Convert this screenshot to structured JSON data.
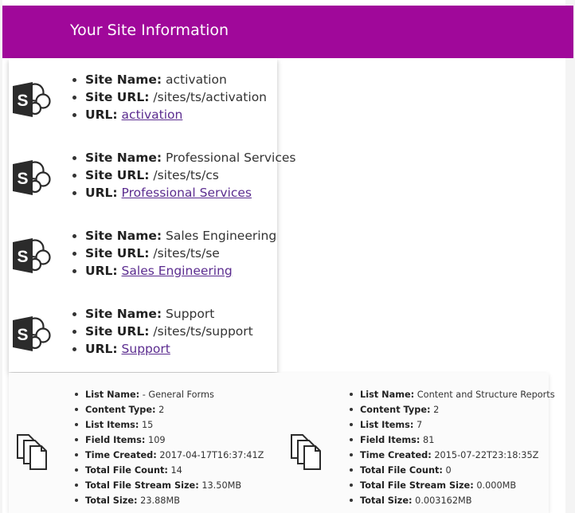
{
  "header": {
    "title": "Your Site Information",
    "color": "#a0089a"
  },
  "sites": [
    {
      "name_label": "Site Name:",
      "name": "activation",
      "site_url_label": "Site URL:",
      "site_url": "/sites/ts/activation",
      "url_label": "URL:",
      "url_text": "activation",
      "icon": "sharepoint-logo-icon"
    },
    {
      "name_label": "Site Name:",
      "name": "Professional Services",
      "site_url_label": "Site URL:",
      "site_url": "/sites/ts/cs",
      "url_label": "URL:",
      "url_text": "Professional Services",
      "icon": "sharepoint-logo-icon"
    },
    {
      "name_label": "Site Name:",
      "name": "Sales Engineering",
      "site_url_label": "Site URL:",
      "site_url": "/sites/ts/se",
      "url_label": "URL:",
      "url_text": "Sales Engineering",
      "icon": "sharepoint-logo-icon"
    },
    {
      "name_label": "Site Name:",
      "name": "Support",
      "site_url_label": "Site URL:",
      "site_url": "/sites/ts/support",
      "url_label": "URL:",
      "url_text": "Support",
      "icon": "sharepoint-logo-icon"
    }
  ],
  "lists": [
    {
      "icon": "document-library-icon",
      "fields": [
        {
          "label": "List Name:",
          "value": "- General Forms"
        },
        {
          "label": "Content Type:",
          "value": "2"
        },
        {
          "label": "List Items:",
          "value": "15"
        },
        {
          "label": "Field Items:",
          "value": "109"
        },
        {
          "label": "Time Created:",
          "value": "2017-04-17T16:37:41Z"
        },
        {
          "label": "Total File Count:",
          "value": "14"
        },
        {
          "label": "Total File Stream Size:",
          "value": "13.50MB"
        },
        {
          "label": "Total Size:",
          "value": "23.88MB"
        }
      ]
    },
    {
      "icon": "document-library-icon",
      "fields": [
        {
          "label": "List Name:",
          "value": "Content and Structure Reports"
        },
        {
          "label": "Content Type:",
          "value": "2"
        },
        {
          "label": "List Items:",
          "value": "7"
        },
        {
          "label": "Field Items:",
          "value": "81"
        },
        {
          "label": "Time Created:",
          "value": "2015-07-22T23:18:35Z"
        },
        {
          "label": "Total File Count:",
          "value": "0"
        },
        {
          "label": "Total File Stream Size:",
          "value": "0.000MB"
        },
        {
          "label": "Total Size:",
          "value": "0.003162MB"
        }
      ]
    }
  ]
}
